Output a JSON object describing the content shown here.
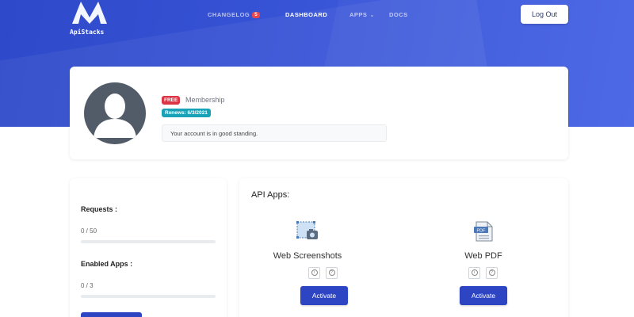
{
  "brand": {
    "name": "ApiStacks"
  },
  "nav": {
    "changelog": "CHANGELOG",
    "changelog_count": "5",
    "dashboard": "DASHBOARD",
    "apps": "APPS",
    "docs": "DOCS",
    "logout": "Log Out"
  },
  "profile": {
    "plan_badge": "FREE",
    "membership": "Membership",
    "renews": "Renews: 6/3/2021",
    "standing": "Your account is in good standing."
  },
  "stats": {
    "requests_label": "Requests :",
    "requests_value": "0 / 50",
    "requests_fraction": 0,
    "apps_label": "Enabled Apps :",
    "apps_value": "0 / 3",
    "apps_fraction": 0
  },
  "apps": {
    "title": "API Apps:",
    "items": [
      {
        "name": "Web Screenshots",
        "action": "Activate",
        "icon": "screenshot-icon"
      },
      {
        "name": "Web PDF",
        "action": "Activate",
        "icon": "pdf-icon"
      }
    ],
    "pdf_icon_text": "PDF"
  },
  "colors": {
    "hero": "#3a56d9",
    "primary_button": "#2d44c3",
    "free_badge": "#dc3545",
    "renews_badge": "#17a2b8",
    "changelog_badge": "#e5484d"
  }
}
